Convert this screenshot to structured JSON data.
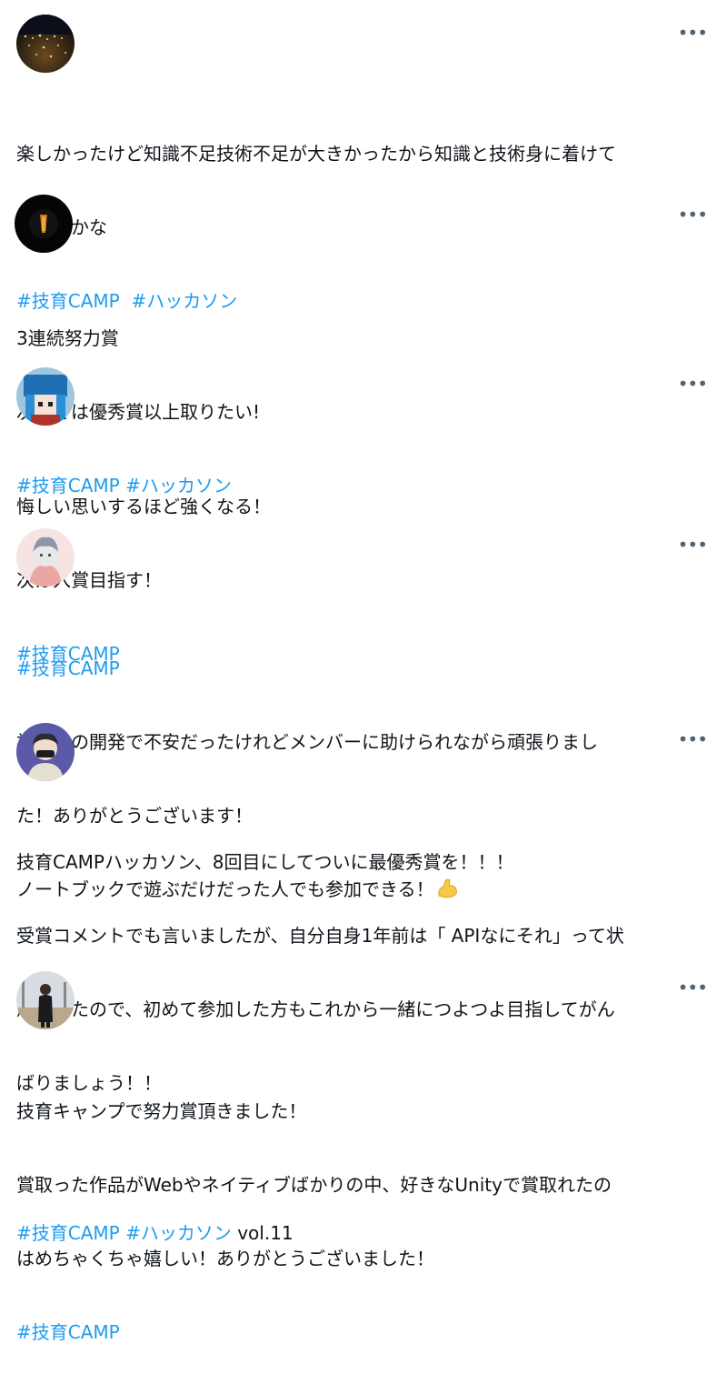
{
  "posts": [
    {
      "lines": [
        "楽しかったけど知識不足技術不足が大きかったから知識と技術身に着けて",
        "再挑戦かな"
      ],
      "hashtags": [
        "#技育CAMP",
        "#ハッカソン"
      ],
      "hashtag_sep": "  "
    },
    {
      "lines": [
        "3連続努力賞",
        "次こそは優秀賞以上取りたい!"
      ],
      "hashtags": [
        "#技育CAMP",
        "#ハッカソン"
      ],
      "hashtag_sep": " "
    },
    {
      "lines": [
        "悔しい思いするほど強くなる！",
        "次は入賞目指す！"
      ],
      "hashtags": [
        "#技育CAMP"
      ]
    },
    {
      "hashtag_first": "#技育CAMP",
      "lines": [
        "初めての開発で不安だったけれどメンバーに助けられながら頑張りまし",
        "た！ありがとうございます！",
        "ノートブックで遊ぶだけだった人でも参加できる！"
      ],
      "emoji": "flexed-biceps"
    },
    {
      "lines": [
        "技育CAMPハッカソン、8回目にしてついに最優秀賞を！！！",
        "受賞コメントでも言いましたが、自分自身1年前は「 APIなにそれ」って状",
        "態だったので、初めて参加した方もこれから一緒につよつよ目指してがん",
        "ばりましょう！！",
        ""
      ],
      "hashtags": [
        "#技育CAMP",
        "#ハッカソン"
      ],
      "hashtag_sep": " ",
      "suffix": " vol.11"
    },
    {
      "lines": [
        "技育キャンプで努力賞頂きました！",
        "賞取った作品がWebやネイティブばかりの中、好きなUnityで賞取れたの",
        "はめちゃくちゃ嬉しい！ありがとうございました！"
      ],
      "hashtags": [
        "#技育CAMP"
      ]
    }
  ],
  "more_label": "•••",
  "colors": {
    "link": "#1d9bf0",
    "text": "#0f1419",
    "muted": "#536471"
  }
}
